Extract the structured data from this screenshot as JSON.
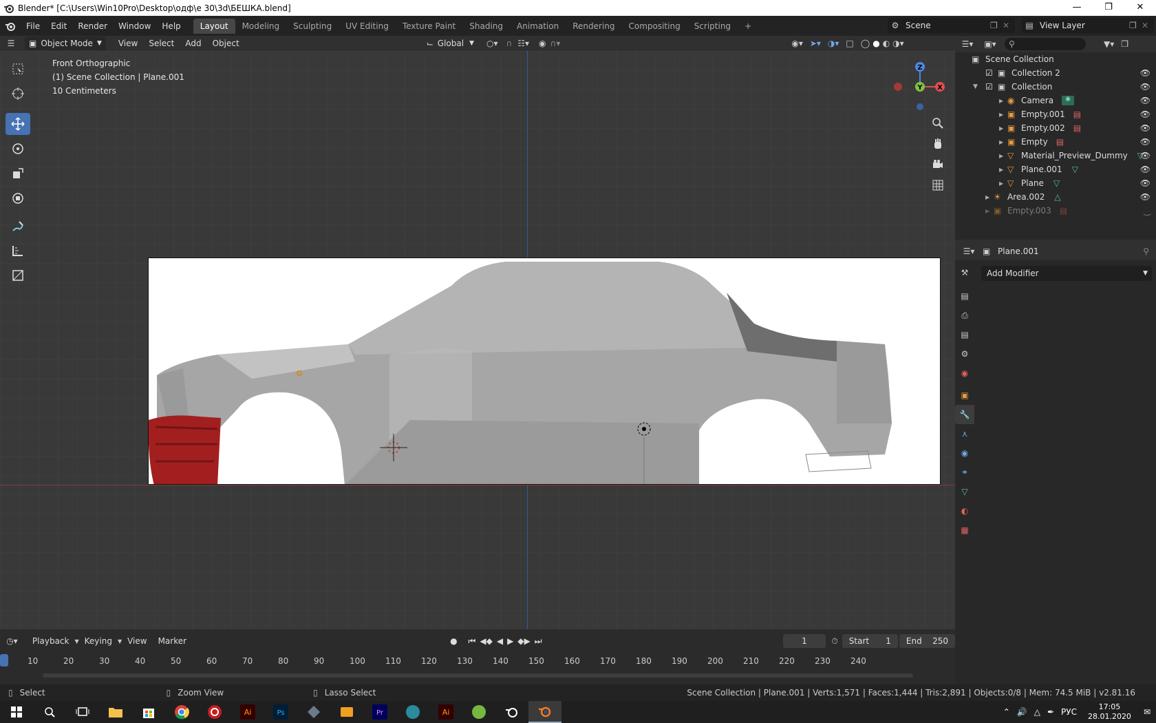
{
  "window": {
    "title": "Blender* [C:\\Users\\Win10Pro\\Desktop\\одф\\е 30\\3d\\БЕШКА.blend]"
  },
  "menu": [
    "File",
    "Edit",
    "Render",
    "Window",
    "Help"
  ],
  "workspaces": [
    "Layout",
    "Modeling",
    "Sculpting",
    "UV Editing",
    "Texture Paint",
    "Shading",
    "Animation",
    "Rendering",
    "Compositing",
    "Scripting"
  ],
  "scene": {
    "name": "Scene",
    "view_layer": "View Layer"
  },
  "header3d": {
    "mode": "Object Mode",
    "menus": [
      "View",
      "Select",
      "Add",
      "Object"
    ],
    "transform": "Global"
  },
  "viewport_info": {
    "view": "Front Orthographic",
    "collection": "(1) Scene Collection | Plane.001",
    "scale": "10 Centimeters"
  },
  "gizmo": {
    "z": "Z",
    "y": "Y",
    "x": "X"
  },
  "outliner": {
    "root": "Scene Collection",
    "items": [
      {
        "label": "Collection 2",
        "type": "collection"
      },
      {
        "label": "Collection",
        "type": "collection"
      },
      {
        "label": "Camera",
        "type": "camera"
      },
      {
        "label": "Empty.001",
        "type": "empty"
      },
      {
        "label": "Empty.002",
        "type": "empty"
      },
      {
        "label": "Empty",
        "type": "empty"
      },
      {
        "label": "Material_Preview_Dummy",
        "type": "mesh"
      },
      {
        "label": "Plane.001",
        "type": "mesh"
      },
      {
        "label": "Plane",
        "type": "mesh"
      },
      {
        "label": "Area.002",
        "type": "light"
      },
      {
        "label": "Empty.003",
        "type": "empty"
      }
    ]
  },
  "properties": {
    "object": "Plane.001",
    "add_modifier": "Add Modifier"
  },
  "timeline": {
    "menus": [
      "Playback",
      "Keying",
      "View",
      "Marker"
    ],
    "current_frame": "1",
    "start_label": "Start",
    "start": "1",
    "end_label": "End",
    "end": "250",
    "ticks": [
      "10",
      "20",
      "30",
      "40",
      "50",
      "60",
      "70",
      "80",
      "90",
      "100",
      "110",
      "120",
      "130",
      "140",
      "150",
      "160",
      "170",
      "180",
      "190",
      "200",
      "210",
      "220",
      "230",
      "240"
    ]
  },
  "status": {
    "select": "Select",
    "zoom": "Zoom View",
    "lasso": "Lasso Select",
    "stats": "Scene Collection | Plane.001 | Verts:1,571 | Faces:1,444 | Tris:2,891 | Objects:0/8 | Mem: 74.5 MiB | v2.81.16"
  },
  "taskbar": {
    "lang": "РУС",
    "time": "17:05",
    "date": "28.01.2020"
  },
  "colors": {
    "accent": "#4772b3",
    "x_axis": "#e34f4f",
    "y_axis": "#7fc241",
    "z_axis": "#4f87e3"
  }
}
